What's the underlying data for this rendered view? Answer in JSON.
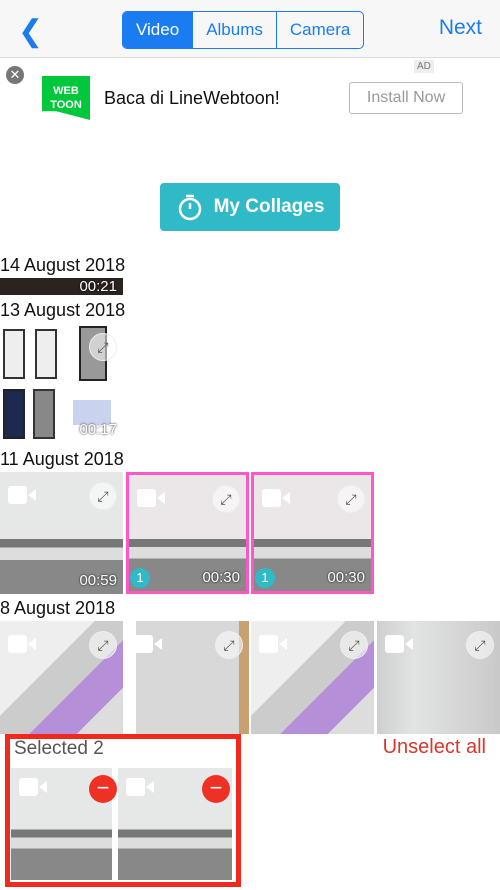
{
  "header": {
    "tabs": [
      {
        "label": "Video",
        "active": true
      },
      {
        "label": "Albums",
        "active": false
      },
      {
        "label": "Camera",
        "active": false
      }
    ],
    "next_label": "Next"
  },
  "ad": {
    "logo": "WEB TOON",
    "text": "Baca di LineWebtoon!",
    "badge": "AD",
    "install_label": "Install Now"
  },
  "collages_label": "My Collages",
  "groups": [
    {
      "date": "14 August 2018",
      "durations": [
        "00:21"
      ]
    },
    {
      "date": "13 August 2018",
      "durations": [
        "00:17"
      ]
    },
    {
      "date": "11 August 2018",
      "durations": [
        "00:59",
        "00:30",
        "00:30"
      ],
      "selected": [
        null,
        "1",
        "1"
      ]
    },
    {
      "date": "8 August 2018",
      "durations": [
        "",
        "",
        "",
        ""
      ]
    }
  ],
  "selection": {
    "label": "Selected 2",
    "unselect_label": "Unselect all",
    "count": 2
  },
  "colors": {
    "accent": "#1a7cf0",
    "teal": "#30b9c7",
    "red": "#f0281e"
  }
}
